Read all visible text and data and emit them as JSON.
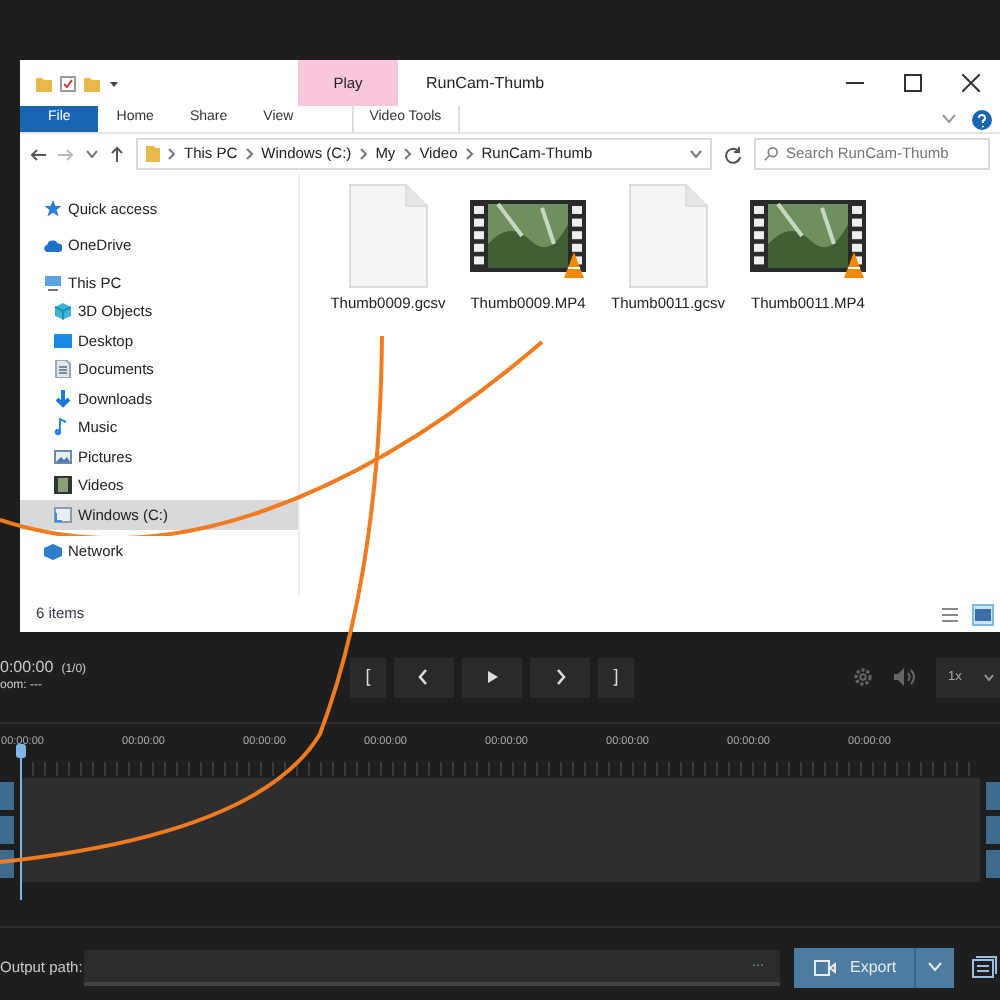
{
  "explorer": {
    "title": "RunCam-Thumb",
    "context_tab": "Play",
    "ribbon_tabs": [
      {
        "label": "File",
        "kind": "file"
      },
      {
        "label": "Home",
        "kind": "plain"
      },
      {
        "label": "Share",
        "kind": "plain"
      },
      {
        "label": "View",
        "kind": "plain"
      },
      {
        "label": "Video Tools",
        "kind": "context"
      }
    ],
    "breadcrumb": [
      "This PC",
      "Windows (C:)",
      "My",
      "Video",
      "RunCam-Thumb"
    ],
    "search": {
      "placeholder": "Search RunCam-Thumb"
    },
    "nav_items": [
      {
        "label": "Quick access",
        "kind": "star",
        "selected": false
      },
      {
        "label": "OneDrive",
        "kind": "cloud",
        "selected": false
      },
      {
        "label": "This PC",
        "kind": "pc",
        "selected": false,
        "children": [
          {
            "label": "3D Objects",
            "kind": "cube",
            "selected": false
          },
          {
            "label": "Desktop",
            "kind": "desktop",
            "selected": false
          },
          {
            "label": "Documents",
            "kind": "doc",
            "selected": false
          },
          {
            "label": "Downloads",
            "kind": "download",
            "selected": false
          },
          {
            "label": "Music",
            "kind": "music",
            "selected": false
          },
          {
            "label": "Pictures",
            "kind": "picture",
            "selected": false
          },
          {
            "label": "Videos",
            "kind": "film",
            "selected": false
          },
          {
            "label": "Windows (C:)",
            "kind": "drive",
            "selected": true
          }
        ]
      },
      {
        "label": "Network",
        "kind": "network",
        "selected": false
      }
    ],
    "files": [
      {
        "name": "Thumb0009.gcsv",
        "kind": "document"
      },
      {
        "name": "Thumb0009.MP4",
        "kind": "video"
      },
      {
        "name": "Thumb0011.gcsv",
        "kind": "document"
      },
      {
        "name": "Thumb0011.MP4",
        "kind": "video"
      }
    ],
    "status": "6 items",
    "view_buttons": [
      {
        "kind": "details",
        "selected": false
      },
      {
        "kind": "large-icons",
        "selected": true
      }
    ]
  },
  "player": {
    "timecode": "0:00:00",
    "frame": "(1/0)",
    "zoom": "oom: ---",
    "transport": [
      {
        "kind": "text",
        "label": "["
      },
      {
        "kind": "prev"
      },
      {
        "kind": "play"
      },
      {
        "kind": "next"
      },
      {
        "kind": "text",
        "label": "]"
      }
    ],
    "speed": "1x",
    "ruler_labels": [
      "00:00:00",
      "00:00:00",
      "00:00:00",
      "00:00:00",
      "00:00:00",
      "00:00:00",
      "00:00:00",
      "00:00:00"
    ]
  },
  "output": {
    "label": "Output path:",
    "browse": "...",
    "export": "Export"
  }
}
